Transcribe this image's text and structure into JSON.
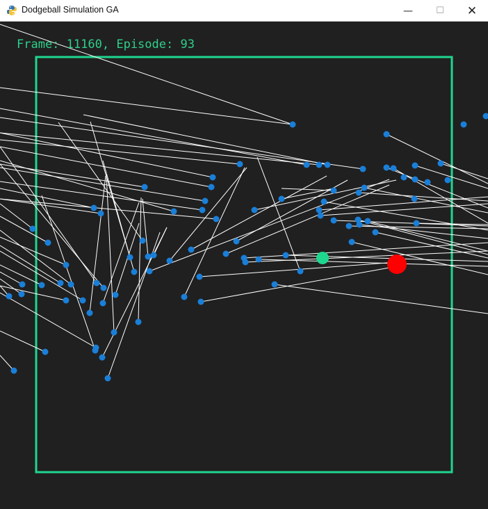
{
  "window": {
    "title": "Dodgeball Simulation GA",
    "minimize_glyph": "—",
    "maximize_glyph": "☐",
    "close_glyph": "✕",
    "app_icon": "python-snake-icon"
  },
  "hud": {
    "frame_label": "Frame:",
    "frame": "11160",
    "episode_label": "Episode:",
    "episode": "93"
  },
  "bottom_hud": {
    "text": ""
  },
  "colors": {
    "background": "#202020",
    "arena_border": "#1fd68f",
    "hud_text": "#2ed08a",
    "dodgeball_blue": "#1a7fd8",
    "trail_white": "#ffffff",
    "agent_green": "#1fd68f",
    "target_red": "#ff0000"
  }
}
